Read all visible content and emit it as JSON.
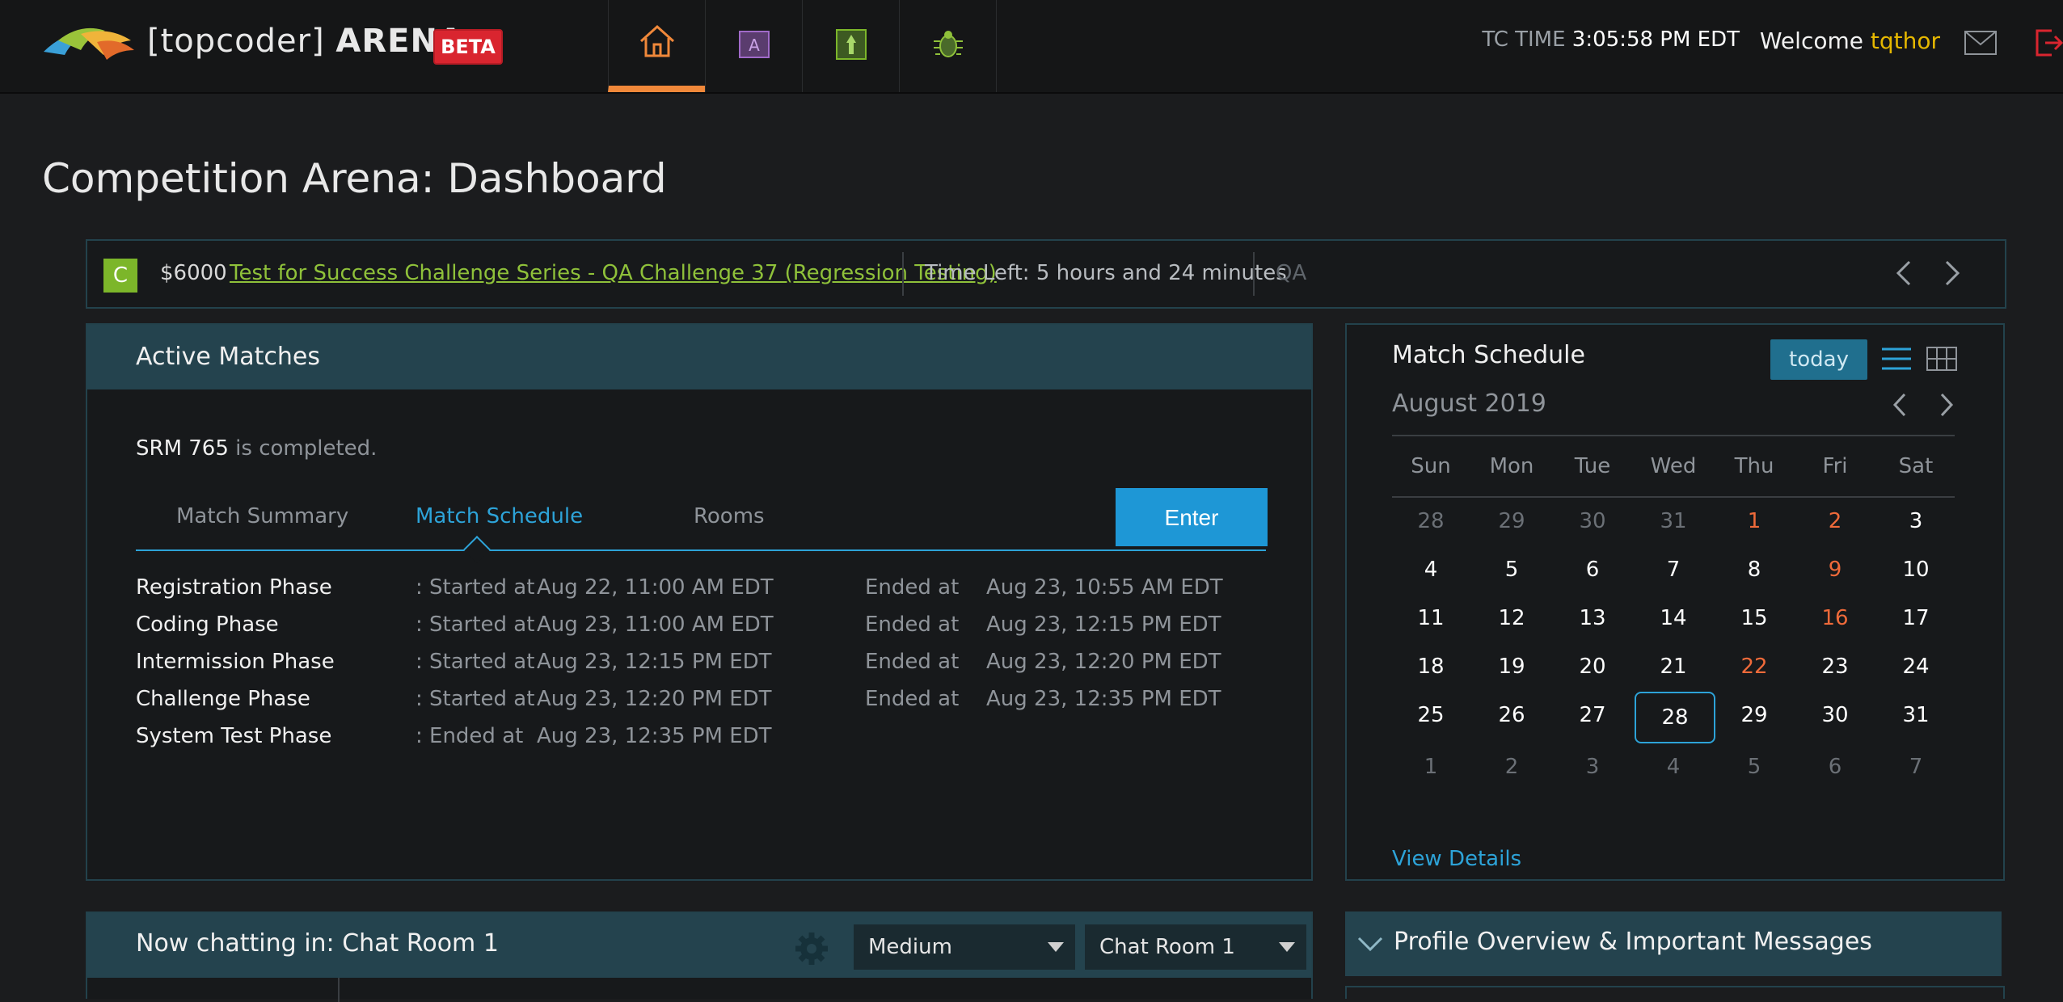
{
  "header": {
    "logo_text_main": "[topcoder]",
    "logo_text_brand": "ARENA",
    "beta_label": "BETA",
    "nav_tabs": [
      {
        "name": "home",
        "icon": "home-icon"
      },
      {
        "name": "practice",
        "icon": "a-icon"
      },
      {
        "name": "rankings",
        "icon": "trophy-icon"
      },
      {
        "name": "bugs",
        "icon": "bug-icon"
      }
    ],
    "tc_time_label": "TC TIME",
    "tc_time_value": "3:05:58 PM EDT",
    "welcome_label": "Welcome",
    "username": "tqthor"
  },
  "page": {
    "title": "Competition Arena: Dashboard"
  },
  "challenge_bar": {
    "badge": "C",
    "prize": "$6000",
    "challenge_title": "Test for Success Challenge Series - QA Challenge 37 (Regression Testing)",
    "time_left": "Time Left: 5 hours and 24 minutes",
    "track": "QA"
  },
  "active_matches": {
    "title": "Active Matches",
    "match_name": "SRM 765",
    "status_text": "is completed.",
    "tabs": [
      "Match Summary",
      "Match Schedule",
      "Rooms"
    ],
    "active_tab": "Match Schedule",
    "enter_label": "Enter",
    "phases": [
      {
        "name": "Registration Phase",
        "start_label": ": Started at",
        "start": "Aug 22, 11:00 AM EDT",
        "end_label": "Ended at",
        "end": "Aug 23, 10:55 AM EDT"
      },
      {
        "name": "Coding Phase",
        "start_label": ": Started at",
        "start": "Aug 23, 11:00 AM EDT",
        "end_label": "Ended at",
        "end": "Aug 23, 12:15 PM EDT"
      },
      {
        "name": "Intermission Phase",
        "start_label": ": Started at",
        "start": "Aug 23, 12:15 PM EDT",
        "end_label": "Ended at",
        "end": "Aug 23, 12:20 PM EDT"
      },
      {
        "name": "Challenge Phase",
        "start_label": ": Started at",
        "start": "Aug 23, 12:20 PM EDT",
        "end_label": "Ended at",
        "end": "Aug 23, 12:35 PM EDT"
      },
      {
        "name": "System Test Phase",
        "start_label": ": Ended at",
        "start": "Aug 23, 12:35 PM EDT",
        "end_label": "",
        "end": ""
      }
    ]
  },
  "match_schedule": {
    "title": "Match Schedule",
    "today_label": "today",
    "month": "August 2019",
    "weekdays": [
      "Sun",
      "Mon",
      "Tue",
      "Wed",
      "Thu",
      "Fri",
      "Sat"
    ],
    "weeks": [
      [
        "28",
        "29",
        "30",
        "31",
        "1",
        "2",
        "3"
      ],
      [
        "4",
        "5",
        "6",
        "7",
        "8",
        "9",
        "10"
      ],
      [
        "11",
        "12",
        "13",
        "14",
        "15",
        "16",
        "17"
      ],
      [
        "18",
        "19",
        "20",
        "21",
        "22",
        "23",
        "24"
      ],
      [
        "25",
        "26",
        "27",
        "28",
        "29",
        "30",
        "31"
      ],
      [
        "1",
        "2",
        "3",
        "4",
        "5",
        "6",
        "7"
      ]
    ],
    "muted_cells": [
      [
        0,
        0
      ],
      [
        0,
        1
      ],
      [
        0,
        2
      ],
      [
        0,
        3
      ],
      [
        5,
        0
      ],
      [
        5,
        1
      ],
      [
        5,
        2
      ],
      [
        5,
        3
      ],
      [
        5,
        4
      ],
      [
        5,
        5
      ],
      [
        5,
        6
      ]
    ],
    "highlight_cells": [
      [
        0,
        4
      ],
      [
        0,
        5
      ],
      [
        1,
        5
      ],
      [
        2,
        5
      ],
      [
        3,
        4
      ]
    ],
    "today_cell": [
      4,
      3
    ],
    "highlight_color": "#ef6a3a",
    "view_details_label": "View Details"
  },
  "chat": {
    "title": "Now chatting in: Chat Room 1",
    "font_size_value": "Medium",
    "room_value": "Chat Room 1"
  },
  "profile": {
    "title": "Profile Overview & Important Messages"
  }
}
